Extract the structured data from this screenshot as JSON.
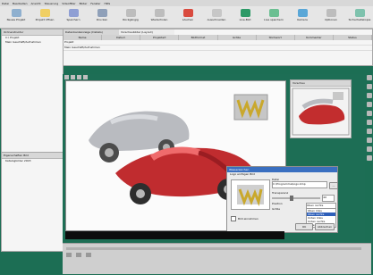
{
  "menu": [
    "Datei",
    "Bearbeiten",
    "Ansicht",
    "Steuerung",
    "Videofilter",
    "Bilder",
    "Fenster",
    "Hilfe"
  ],
  "toolbar": [
    {
      "label": "Neues Projekt",
      "color": "#8fb0cf"
    },
    {
      "label": "Projekt öffnen",
      "color": "#f0cf63"
    },
    {
      "label": "Speichern",
      "color": "#8f9fd4"
    },
    {
      "label": "Drucken",
      "color": "#8fa0b9"
    },
    {
      "label": "Rückgängig",
      "color": "#bdbdbd"
    },
    {
      "label": "Wiederholen",
      "color": "#bdbdbd"
    },
    {
      "label": "Löschen",
      "color": "#d94b3f"
    },
    {
      "label": "Ausschneiden",
      "color": "#c7c7c7"
    },
    {
      "label": "Live-Bild",
      "color": "#2d9a67"
    },
    {
      "label": "Live speichern",
      "color": "#6bbf92"
    },
    {
      "label": "Kamera",
      "color": "#5aa7d7"
    },
    {
      "label": "Optionen",
      "color": "#bdbdbd"
    },
    {
      "label": "Sicherheitskopie",
      "color": "#7ec2ad"
    }
  ],
  "tree": {
    "header": "Ordnerstruktur",
    "items": [
      "C:\\ Projekt",
      "Mein Geschäft/Aufnahmen"
    ]
  },
  "list": {
    "tabs": [
      "Datenbankanzeige (Details)",
      "Vorschaubilder (Layout)"
    ],
    "columns": [
      "Name",
      "Datum",
      "Projektart",
      "Bildformat",
      "Größe",
      "Stichwort",
      "Kommentar",
      "Status"
    ],
    "rows": [
      [
        "Projekt",
        "",
        "",
        "",
        "",
        "",
        "",
        ""
      ],
      [
        "Mein Geschäft/Aufnahmen",
        "",
        "",
        "",
        "",
        "",
        "",
        ""
      ]
    ]
  },
  "props": {
    "header": "Eigenschaften Bild",
    "value": "Katalogbilder 2003"
  },
  "preview_panel": {
    "title": "Vorschau"
  },
  "dialog": {
    "title": "Wasserzeichen",
    "subtitle": "Logo einfügen Bild",
    "path_label": "Datei",
    "path_value": "C:\\Programme\\logo.bmp",
    "transparency_label": "Transparenz",
    "transparency_value": "40",
    "position_label": "Position",
    "position_option": "Oben rechts",
    "scale_label": "Größe",
    "check_label": "Bild einrahmen",
    "options": [
      "Oben links",
      "Oben rechts",
      "Unten links",
      "Unten rechts",
      "Mitte"
    ],
    "ok": "OK",
    "cancel": "Abbrechen"
  }
}
